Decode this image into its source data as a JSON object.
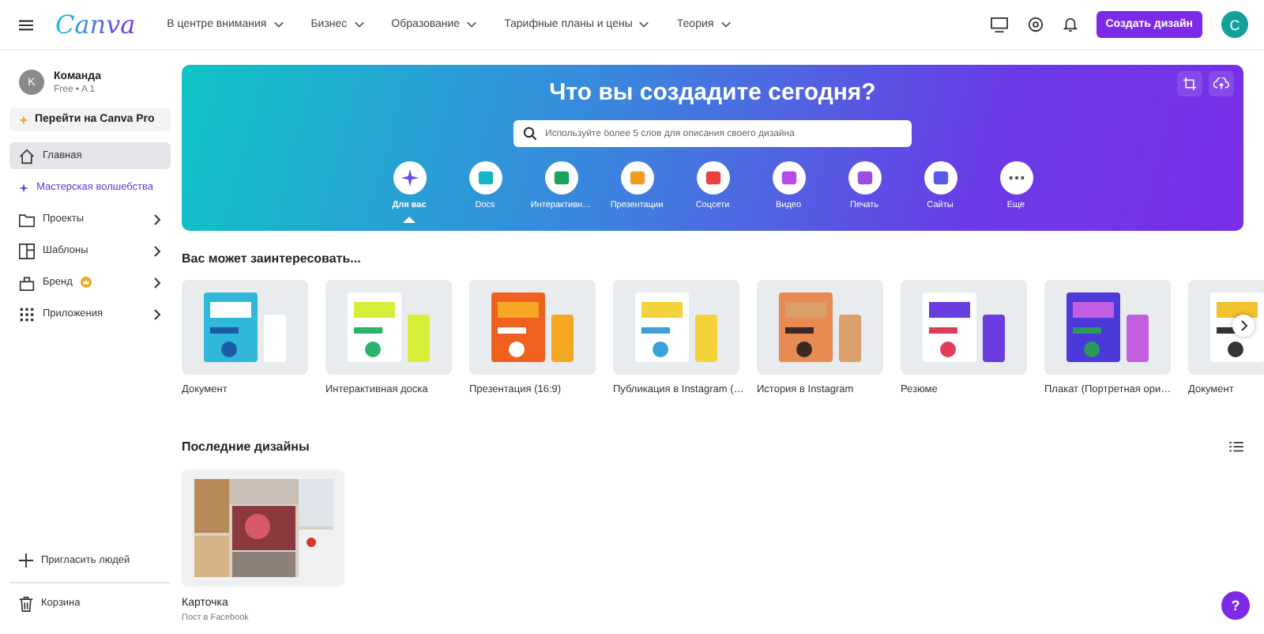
{
  "header": {
    "logo": "Canva",
    "nav": [
      {
        "label": "В центре внимания"
      },
      {
        "label": "Бизнес"
      },
      {
        "label": "Образование"
      },
      {
        "label": "Тарифные планы и цены"
      },
      {
        "label": "Теория"
      }
    ],
    "create_button": "Создать дизайн",
    "avatar": "C"
  },
  "sidebar": {
    "team": {
      "initial": "K",
      "name": "Команда",
      "plan": "Free • A 1"
    },
    "pro_button": "Перейти на Canva Pro",
    "items": [
      {
        "label": "Главная",
        "kind": "nav",
        "selected": true,
        "has_submenu": false,
        "badge": false
      },
      {
        "label": "Мастерская волшебства",
        "kind": "magic",
        "selected": false,
        "has_submenu": false,
        "badge": false
      },
      {
        "label": "Проекты",
        "kind": "nav",
        "selected": false,
        "has_submenu": true,
        "badge": false
      },
      {
        "label": "Шаблоны",
        "kind": "nav",
        "selected": false,
        "has_submenu": true,
        "badge": false
      },
      {
        "label": "Бренд",
        "kind": "nav",
        "selected": false,
        "has_submenu": true,
        "badge": true
      },
      {
        "label": "Приложения",
        "kind": "nav",
        "selected": false,
        "has_submenu": true,
        "badge": false
      }
    ],
    "invite": "Пригласить людей",
    "trash": "Корзина"
  },
  "hero": {
    "title": "Что вы создадите сегодня?",
    "search": {
      "placeholder": "Используйте более 5 слов для описания своего дизайна"
    },
    "categories": [
      {
        "label": "Для вас",
        "selected": true
      },
      {
        "label": "Docs",
        "selected": false
      },
      {
        "label": "Интерактивн…",
        "selected": false
      },
      {
        "label": "Презентации",
        "selected": false
      },
      {
        "label": "Соцсети",
        "selected": false
      },
      {
        "label": "Видео",
        "selected": false
      },
      {
        "label": "Печать",
        "selected": false
      },
      {
        "label": "Сайты",
        "selected": false
      },
      {
        "label": "Еще",
        "selected": false
      }
    ]
  },
  "suggestions": {
    "title": "Вас может заинтересовать...",
    "items": [
      {
        "label": "Документ"
      },
      {
        "label": "Интерактивная доска"
      },
      {
        "label": "Презентация (16:9)"
      },
      {
        "label": "Публикация в Instagram (…"
      },
      {
        "label": "История в Instagram"
      },
      {
        "label": "Резюме"
      },
      {
        "label": "Плакат (Портретная ори…"
      },
      {
        "label": "Документ"
      }
    ]
  },
  "recent": {
    "title": "Последние дизайны",
    "items": [
      {
        "name": "Карточка",
        "type": "Пост в Facebook"
      }
    ]
  },
  "help_button": "?"
}
